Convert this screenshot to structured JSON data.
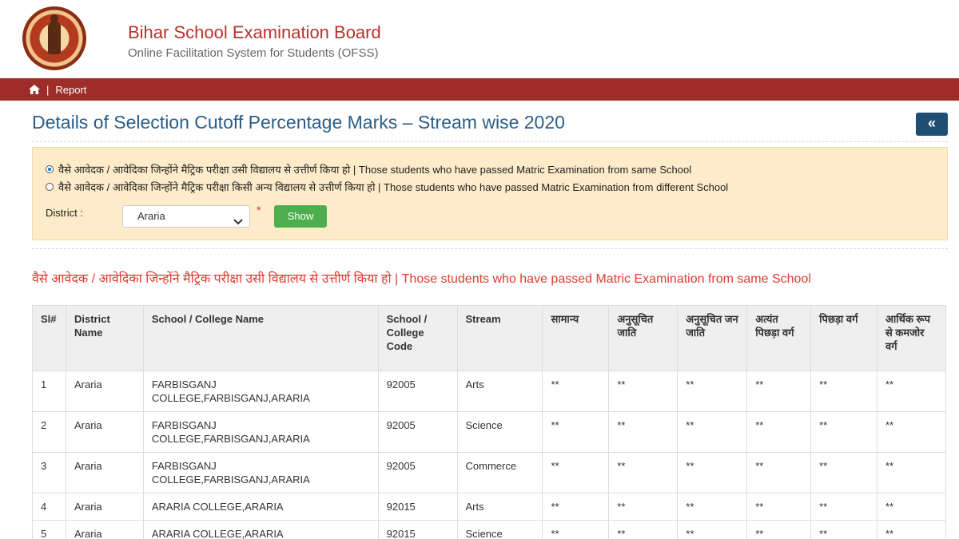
{
  "header": {
    "title": "Bihar School Examination Board",
    "subtitle": "Online Facilitation System for Students (OFSS)"
  },
  "nav": {
    "separator": "|",
    "report_label": "Report"
  },
  "page": {
    "title": "Details of Selection Cutoff Percentage Marks – Stream wise 2020",
    "collapse_label": "«"
  },
  "filters": {
    "option_same": "वैसे आवेदक / आवेदिका जिन्होंने मैट्रिक परीक्षा उसी विद्यालय से उत्तीर्ण किया हो | Those students who have passed Matric Examination from same School",
    "option_different": "वैसे आवेदक / आवेदिका जिन्होंने मैट्रिक परीक्षा किसी अन्य विद्यालय से उत्तीर्ण किया हो | Those students who have passed Matric Examination from different School",
    "selected_option": "same",
    "district_label": "District :",
    "district_value": "Araria",
    "required_mark": "*",
    "show_label": "Show"
  },
  "section": {
    "heading": "वैसे आवेदक / आवेदिका जिन्होंने मैट्रिक परीक्षा उसी विद्यालय से उत्तीर्ण किया हो | Those students who have passed Matric Examination from same School"
  },
  "table": {
    "headers": [
      "Sl#",
      "District Name",
      "School / College Name",
      "School / College Code",
      "Stream",
      "सामान्य",
      "अनुसूचित जाति",
      "अनुसूचित जन जाति",
      "अत्यंत पिछड़ा वर्ग",
      "पिछड़ा वर्ग",
      "आर्थिक रूप से कमजोर वर्ग"
    ],
    "rows": [
      [
        "1",
        "Araria",
        "FARBISGANJ COLLEGE,FARBISGANJ,ARARIA",
        "92005",
        "Arts",
        "**",
        "**",
        "**",
        "**",
        "**",
        "**"
      ],
      [
        "2",
        "Araria",
        "FARBISGANJ COLLEGE,FARBISGANJ,ARARIA",
        "92005",
        "Science",
        "**",
        "**",
        "**",
        "**",
        "**",
        "**"
      ],
      [
        "3",
        "Araria",
        "FARBISGANJ COLLEGE,FARBISGANJ,ARARIA",
        "92005",
        "Commerce",
        "**",
        "**",
        "**",
        "**",
        "**",
        "**"
      ],
      [
        "4",
        "Araria",
        "ARARIA COLLEGE,ARARIA",
        "92015",
        "Arts",
        "**",
        "**",
        "**",
        "**",
        "**",
        "**"
      ],
      [
        "5",
        "Araria",
        "ARARIA COLLEGE,ARARIA",
        "92015",
        "Science",
        "**",
        "**",
        "**",
        "**",
        "**",
        "**"
      ]
    ]
  },
  "colors": {
    "brand_red": "#b8322b",
    "nav_bg": "#9e2d2a",
    "title_blue": "#2a5d88",
    "panel_bg": "#fdebc9",
    "show_green": "#4cae4c",
    "heading_red": "#e23b32"
  }
}
